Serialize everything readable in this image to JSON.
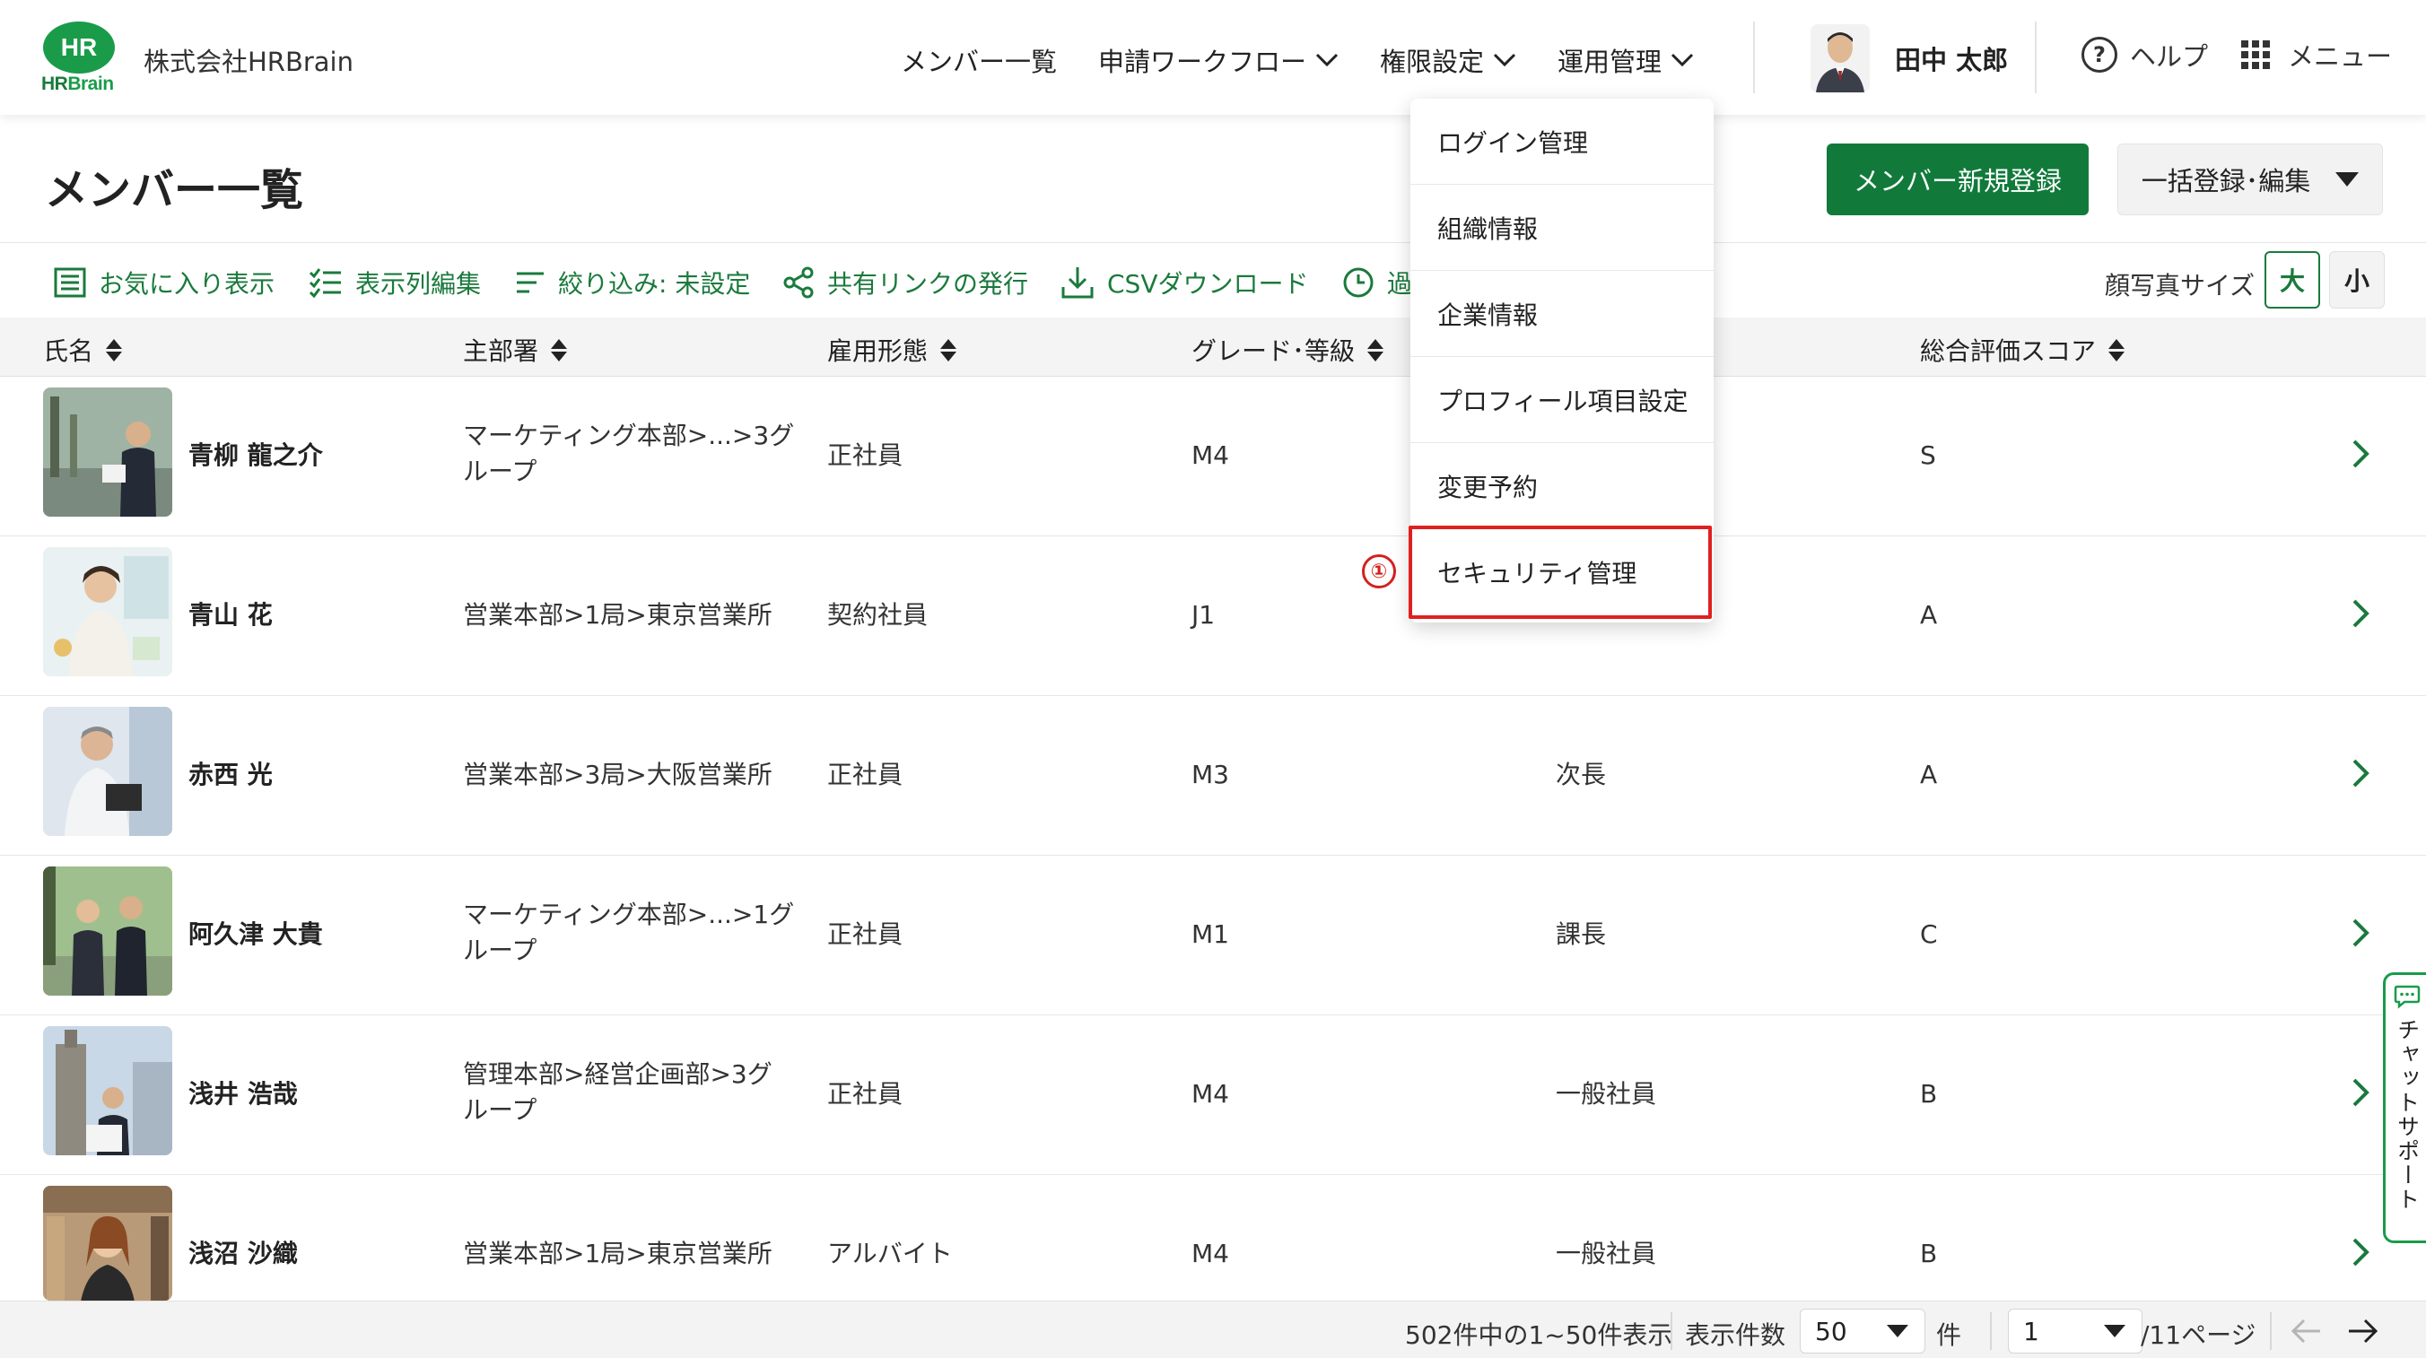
{
  "header": {
    "logo_mark": "HR",
    "logo_text_hr": "HR",
    "logo_text_brain": "Brain",
    "company_name": "株式会社HRBrain",
    "nav": [
      {
        "label": "メンバー一覧",
        "has_chevron": false
      },
      {
        "label": "申請ワークフロー",
        "has_chevron": true
      },
      {
        "label": "権限設定",
        "has_chevron": true
      },
      {
        "label": "運用管理",
        "has_chevron": true
      }
    ],
    "user_name": "田中 太郎",
    "help_label": "ヘルプ",
    "menu_label": "メニュー"
  },
  "page": {
    "title": "メンバー一覧",
    "primary_button": "メンバー新規登録",
    "secondary_button": "一括登録･編集"
  },
  "toolbar": {
    "favorites": "お気に入り表示",
    "columns": "表示列編集",
    "filter": "絞り込み: 未設定",
    "share": "共有リンクの発行",
    "csv": "CSVダウンロード",
    "history": "過",
    "photo_size_label": "顔写真サイズ",
    "size_large": "大",
    "size_small": "小"
  },
  "table": {
    "columns": [
      "氏名",
      "主部署",
      "雇用形態",
      "グレード･等級",
      "総合評価スコア"
    ],
    "rows": [
      {
        "name": "青柳 龍之介",
        "dept": "マーケティング本部>...>3グループ",
        "employment": "正社員",
        "grade": "M4",
        "position": "",
        "score": "S"
      },
      {
        "name": "青山 花",
        "dept": "営業本部>1局>東京営業所",
        "employment": "契約社員",
        "grade": "J1",
        "position": "",
        "score": "A"
      },
      {
        "name": "赤西 光",
        "dept": "営業本部>3局>大阪営業所",
        "employment": "正社員",
        "grade": "M3",
        "position": "次長",
        "score": "A"
      },
      {
        "name": "阿久津 大貴",
        "dept": "マーケティング本部>...>1グループ",
        "employment": "正社員",
        "grade": "M1",
        "position": "課長",
        "score": "C"
      },
      {
        "name": "浅井 浩哉",
        "dept": "管理本部>経営企画部>3グループ",
        "employment": "正社員",
        "grade": "M4",
        "position": "一般社員",
        "score": "B"
      },
      {
        "name": "浅沼 沙織",
        "dept": "営業本部>1局>東京営業所",
        "employment": "アルバイト",
        "grade": "M4",
        "position": "一般社員",
        "score": "B"
      }
    ]
  },
  "dropdown": {
    "items": [
      "ログイン管理",
      "組織情報",
      "企業情報",
      "プロフィール項目設定",
      "変更予約",
      "セキュリティ管理"
    ],
    "step_marker": "①"
  },
  "footer": {
    "summary": "502件中の1~50件表示",
    "per_page_label": "表示件数",
    "per_page_value": "50",
    "per_page_unit": "件",
    "page_value": "1",
    "page_total": "/11ページ"
  },
  "chat": {
    "label": "チャットサポート"
  },
  "colors": {
    "brand_green": "#117a3b",
    "accent_green": "#1a9b4a",
    "highlight_red": "#e02020"
  }
}
